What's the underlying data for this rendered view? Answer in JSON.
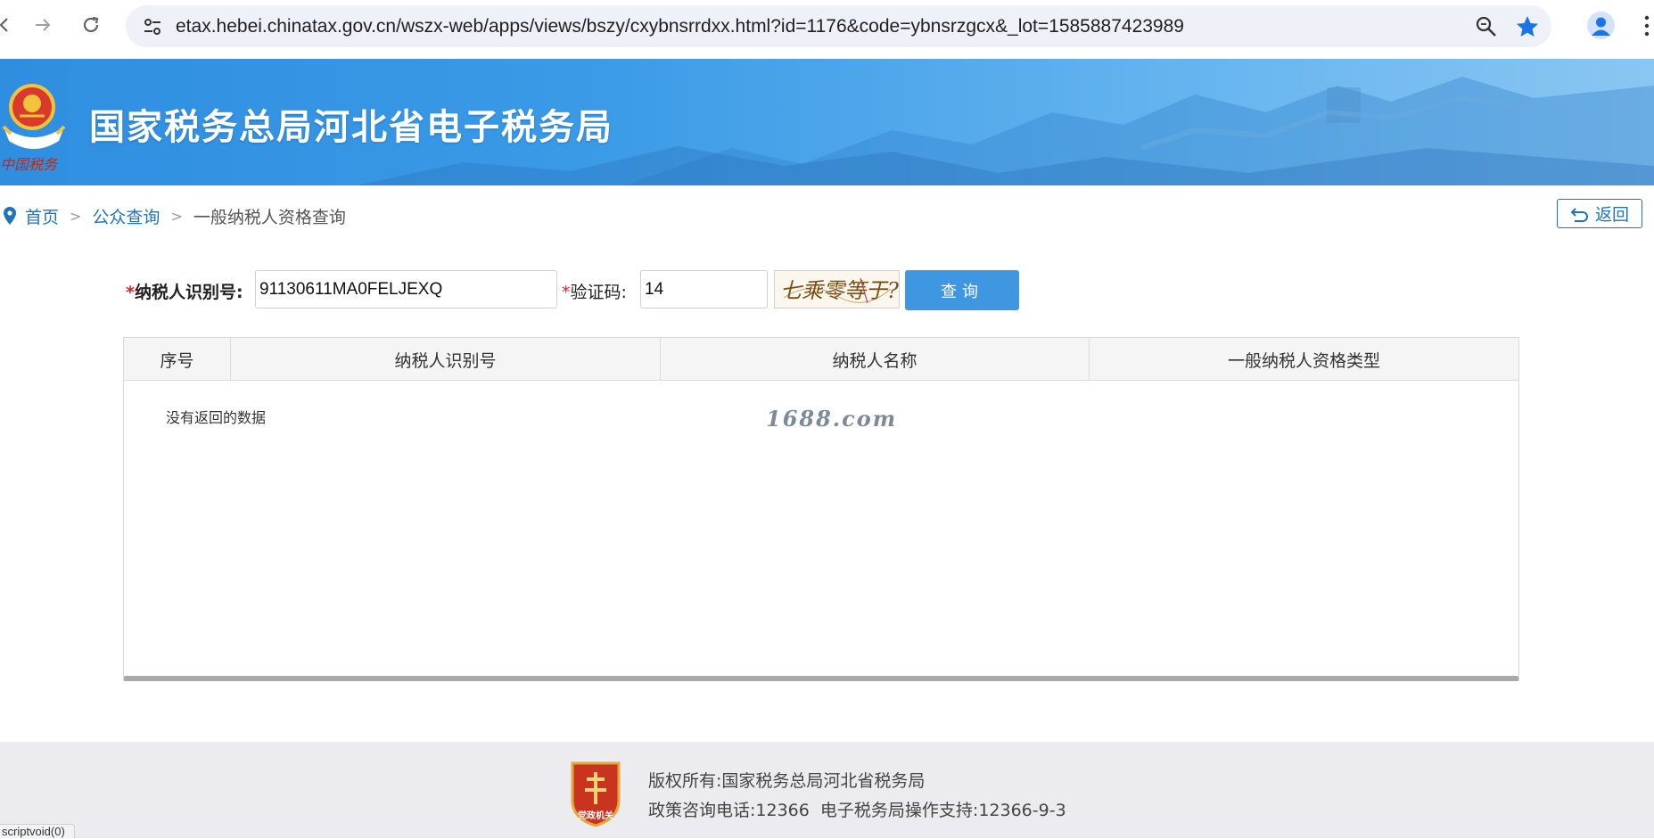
{
  "browser": {
    "url": "etax.hebei.chinatax.gov.cn/wszx-web/apps/views/bszy/cxybnsrrdxx.html?id=1176&code=ybnsrzgcx&_lot=1585887423989",
    "status_text": "scriptvoid(0)"
  },
  "header": {
    "title": "国家税务总局河北省电子税务局",
    "emblem_caption": "中国税务"
  },
  "breadcrumb": {
    "home": "首页",
    "sep": ">",
    "public_query": "公众查询",
    "current": "一般纳税人资格查询"
  },
  "back_button": {
    "label": "返回"
  },
  "form": {
    "required_mark": "*",
    "taxpayer_id_label": "纳税人识别号:",
    "taxpayer_id_value": "91130611MA0FELJEXQ",
    "captcha_label": "验证码:",
    "captcha_value": "14",
    "captcha_image_text": "七乘零等于?",
    "query_button": "查询"
  },
  "table": {
    "columns": [
      "序号",
      "纳税人识别号",
      "纳税人名称",
      "一般纳税人资格类型"
    ],
    "empty_message": "没有返回的数据",
    "watermark": "1688.com"
  },
  "footer": {
    "copyright": "版权所有:国家税务总局河北省税务局",
    "contact": "政策咨询电话:12366  电子税务局操作支持:12366-9-3",
    "logo_caption": "党政机关"
  },
  "colors": {
    "banner_blue": "#3a9ae6",
    "link_blue": "#1e73be",
    "button_blue": "#3f97e2",
    "required_red": "#e02020"
  }
}
